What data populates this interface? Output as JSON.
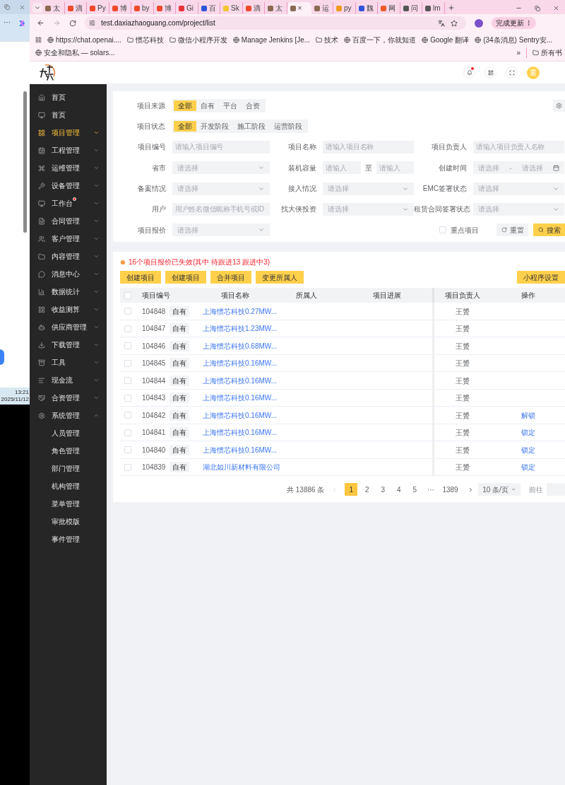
{
  "background_window": {
    "menu": "···",
    "time": "13:21",
    "date": "2025/11/12"
  },
  "browser": {
    "tabs": [
      {
        "title": "太",
        "color": "#8a6a55",
        "selected": false
      },
      {
        "title": "滴",
        "color": "#f04a2c",
        "selected": false
      },
      {
        "title": "Py",
        "color": "#f04a2c",
        "selected": false
      },
      {
        "title": "博",
        "color": "#f04a2c",
        "selected": false
      },
      {
        "title": "by",
        "color": "#f04a2c",
        "selected": false
      },
      {
        "title": "博",
        "color": "#f04a2c",
        "selected": false
      },
      {
        "title": "Gi",
        "color": "#e8353a",
        "selected": false
      },
      {
        "title": "百",
        "color": "#3056d8",
        "selected": false
      },
      {
        "title": "Sk",
        "color": "#f2c633",
        "selected": false
      },
      {
        "title": "滴",
        "color": "#f04a2c",
        "selected": false
      },
      {
        "title": "太",
        "color": "#8a6a55",
        "selected": false
      },
      {
        "title": "×",
        "color": "#8a6a55",
        "selected": true
      },
      {
        "title": "运",
        "color": "#8a6a55",
        "selected": false
      },
      {
        "title": "py",
        "color": "#f29a1c",
        "selected": false
      },
      {
        "title": "魏",
        "color": "#3056d8",
        "selected": false
      },
      {
        "title": "网",
        "color": "#f05a28",
        "selected": false
      },
      {
        "title": "问",
        "color": "#555555",
        "selected": false
      },
      {
        "title": "lm",
        "color": "#555555",
        "selected": false
      }
    ],
    "url": "test.daxiazhaoguang.com/project/list",
    "update_button": "完成更新",
    "bookmarks": [
      {
        "title": "https://chat.openai....",
        "kind": "site"
      },
      {
        "title": "惯芯科技",
        "kind": "folder"
      },
      {
        "title": "微信小程序开发",
        "kind": "folder"
      },
      {
        "title": "Manage Jenkins [Je...",
        "kind": "site"
      },
      {
        "title": "技术",
        "kind": "folder"
      },
      {
        "title": "百度一下，你就知道",
        "kind": "site"
      },
      {
        "title": "Google 翻译",
        "kind": "site"
      },
      {
        "title": "(34条消息) Sentry安...",
        "kind": "site"
      },
      {
        "title": "安全和隐私 — solars...",
        "kind": "site"
      }
    ],
    "more": "»",
    "all_bookmarks": "所有书"
  },
  "header": {
    "notification_dot": true,
    "avatar": "董"
  },
  "sidebar": {
    "items": [
      {
        "label": "首页",
        "kind": "link",
        "selected": false
      },
      {
        "label": "首页",
        "kind": "link",
        "selected": false
      },
      {
        "label": "项目管理",
        "kind": "submenu",
        "selected": true,
        "expanded": false
      },
      {
        "label": "工程管理",
        "kind": "submenu",
        "selected": false,
        "expanded": false
      },
      {
        "label": "运维管理",
        "kind": "submenu",
        "selected": false,
        "expanded": false
      },
      {
        "label": "设备管理",
        "kind": "submenu",
        "selected": false,
        "expanded": false
      },
      {
        "label": "工作台",
        "kind": "submenu",
        "selected": false,
        "expanded": false,
        "badge": true
      },
      {
        "label": "合同管理",
        "kind": "submenu",
        "selected": false,
        "expanded": false
      },
      {
        "label": "客户管理",
        "kind": "submenu",
        "selected": false,
        "expanded": false
      },
      {
        "label": "内容管理",
        "kind": "submenu",
        "selected": false,
        "expanded": false
      },
      {
        "label": "消息中心",
        "kind": "submenu",
        "selected": false,
        "expanded": false
      },
      {
        "label": "数据统计",
        "kind": "submenu",
        "selected": false,
        "expanded": false
      },
      {
        "label": "收益测算",
        "kind": "submenu",
        "selected": false,
        "expanded": false
      },
      {
        "label": "供应商管理",
        "kind": "submenu",
        "selected": false,
        "expanded": false
      },
      {
        "label": "下载管理",
        "kind": "submenu",
        "selected": false,
        "expanded": false
      },
      {
        "label": "工具",
        "kind": "submenu",
        "selected": false,
        "expanded": false
      },
      {
        "label": "现金流",
        "kind": "submenu",
        "selected": false,
        "expanded": false
      },
      {
        "label": "合资管理",
        "kind": "submenu",
        "selected": false,
        "expanded": false
      },
      {
        "label": "系统管理",
        "kind": "submenu",
        "selected": false,
        "expanded": true,
        "children": [
          {
            "label": "人员管理",
            "selected": false
          },
          {
            "label": "角色管理",
            "selected": false
          },
          {
            "label": "部门管理",
            "selected": false
          },
          {
            "label": "机构管理",
            "selected": false
          },
          {
            "label": "菜单管理",
            "selected": false
          },
          {
            "label": "审批模版",
            "selected": false
          },
          {
            "label": "事件管理",
            "selected": false
          }
        ]
      }
    ]
  },
  "filters": {
    "segments": [
      {
        "label": "项目来源",
        "options": [
          {
            "label": "全部",
            "selected": true
          },
          {
            "label": "自有",
            "selected": false
          },
          {
            "label": "平台",
            "selected": false
          },
          {
            "label": "合资",
            "selected": false
          }
        ]
      },
      {
        "label": "项目状态",
        "options": [
          {
            "label": "全部",
            "selected": true
          },
          {
            "label": "开发阶段",
            "selected": false
          },
          {
            "label": "施工阶段",
            "selected": false
          },
          {
            "label": "运营阶段",
            "selected": false
          }
        ]
      }
    ],
    "rows": [
      [
        {
          "label": "项目编号",
          "kind": "text",
          "placeholder": "请输入项目编号"
        },
        {
          "label": "项目名称",
          "kind": "text",
          "placeholder": "请输入项目名称"
        },
        {
          "label": "项目负责人",
          "kind": "text",
          "placeholder": "请输入项目负责人名称"
        }
      ],
      [
        {
          "label": "省市",
          "kind": "select",
          "placeholder": "请选择"
        },
        {
          "label": "装机容量",
          "kind": "range",
          "placeholder": "请输入",
          "to": "至",
          "placeholder_to": "请输入"
        },
        {
          "label": "创建时间",
          "kind": "daterange",
          "placeholder": "请选择",
          "to": "-",
          "placeholder_to": "请选择"
        }
      ],
      [
        {
          "label": "备案情况",
          "kind": "select",
          "placeholder": "请选择"
        },
        {
          "label": "接入情况",
          "kind": "select",
          "placeholder": "请选择"
        },
        {
          "label": "EMC签署状态",
          "kind": "select",
          "placeholder": "请选择"
        }
      ],
      [
        {
          "label": "用户",
          "kind": "text",
          "placeholder": "用户姓名微信昵称手机号或ID"
        },
        {
          "label": "找大侠投资",
          "kind": "select",
          "placeholder": "请选择"
        },
        {
          "label": "租赁合同签署状态",
          "kind": "select",
          "placeholder": "请选择"
        }
      ],
      [
        {
          "label": "项目报价",
          "kind": "select",
          "placeholder": "请选择"
        }
      ]
    ],
    "key_project": {
      "label": "重点项目",
      "checked": false
    },
    "reset": "重置",
    "search": "搜索"
  },
  "notice": "16个项目报价已失效(其中 待跟进13 跟进中3)",
  "actions": [
    "创建项目",
    "创建项目",
    "合并项目",
    "变更所属人"
  ],
  "settings_button": "小程序设置",
  "table": {
    "select_all": false,
    "columns": [
      "项目编号",
      "项目名称",
      "所属人",
      "项目进展",
      "项目负责人",
      "操作"
    ],
    "rows": [
      {
        "checked": false,
        "id": "104848",
        "tag": "自有",
        "name": "上海惯芯科技0.27MW...",
        "manager": "王赟"
      },
      {
        "checked": false,
        "id": "104847",
        "tag": "自有",
        "name": "上海惯芯科技1.23MW...",
        "manager": "王赟"
      },
      {
        "checked": false,
        "id": "104846",
        "tag": "自有",
        "name": "上海惯芯科技0.68MW...",
        "manager": "王赟"
      },
      {
        "checked": false,
        "id": "104845",
        "tag": "自有",
        "name": "上海惯芯科技0.16MW...",
        "manager": "王赟"
      },
      {
        "checked": false,
        "id": "104844",
        "tag": "自有",
        "name": "上海惯芯科技0.16MW...",
        "manager": "王赟"
      },
      {
        "checked": false,
        "id": "104843",
        "tag": "自有",
        "name": "上海惯芯科技0.16MW...",
        "manager": "王赟"
      },
      {
        "checked": false,
        "id": "104842",
        "tag": "自有",
        "name": "上海惯芯科技0.16MW...",
        "manager": "王赟",
        "action": "解锁"
      },
      {
        "checked": false,
        "id": "104841",
        "tag": "自有",
        "name": "上海惯芯科技0.16MW...",
        "manager": "王赟",
        "action": "锁定"
      },
      {
        "checked": false,
        "id": "104840",
        "tag": "自有",
        "name": "上海惯芯科技0.16MW...",
        "manager": "王赟",
        "action": "锁定"
      },
      {
        "checked": false,
        "id": "104839",
        "tag": "自有",
        "name": "湖北如川新材料有限公司",
        "manager": "王赟",
        "action": "锁定"
      }
    ]
  },
  "pagination": {
    "total": "共 13886 条",
    "prev_disabled": true,
    "pages": [
      {
        "label": "1",
        "selected": true
      },
      {
        "label": "2",
        "selected": false
      },
      {
        "label": "3",
        "selected": false
      },
      {
        "label": "4",
        "selected": false
      },
      {
        "label": "5",
        "selected": false
      },
      {
        "label": "···",
        "selected": false
      },
      {
        "label": "1389",
        "selected": false
      }
    ],
    "page_size": "10 条/页",
    "goto": "前往"
  }
}
